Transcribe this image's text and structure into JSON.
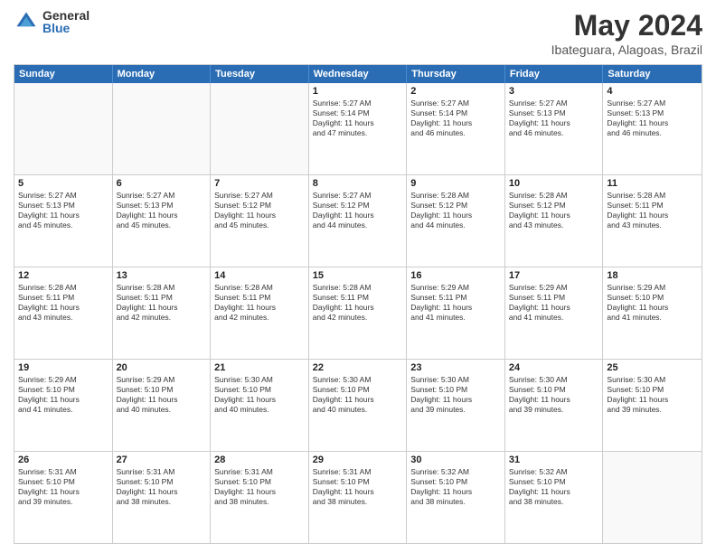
{
  "header": {
    "logo": {
      "general": "General",
      "blue": "Blue"
    },
    "title": "May 2024",
    "location": "Ibateguara, Alagoas, Brazil"
  },
  "calendar": {
    "days_of_week": [
      "Sunday",
      "Monday",
      "Tuesday",
      "Wednesday",
      "Thursday",
      "Friday",
      "Saturday"
    ],
    "weeks": [
      [
        {
          "day": "",
          "empty": true
        },
        {
          "day": "",
          "empty": true
        },
        {
          "day": "",
          "empty": true
        },
        {
          "day": "1",
          "line1": "Sunrise: 5:27 AM",
          "line2": "Sunset: 5:14 PM",
          "line3": "Daylight: 11 hours",
          "line4": "and 47 minutes."
        },
        {
          "day": "2",
          "line1": "Sunrise: 5:27 AM",
          "line2": "Sunset: 5:14 PM",
          "line3": "Daylight: 11 hours",
          "line4": "and 46 minutes."
        },
        {
          "day": "3",
          "line1": "Sunrise: 5:27 AM",
          "line2": "Sunset: 5:13 PM",
          "line3": "Daylight: 11 hours",
          "line4": "and 46 minutes."
        },
        {
          "day": "4",
          "line1": "Sunrise: 5:27 AM",
          "line2": "Sunset: 5:13 PM",
          "line3": "Daylight: 11 hours",
          "line4": "and 46 minutes."
        }
      ],
      [
        {
          "day": "5",
          "line1": "Sunrise: 5:27 AM",
          "line2": "Sunset: 5:13 PM",
          "line3": "Daylight: 11 hours",
          "line4": "and 45 minutes."
        },
        {
          "day": "6",
          "line1": "Sunrise: 5:27 AM",
          "line2": "Sunset: 5:13 PM",
          "line3": "Daylight: 11 hours",
          "line4": "and 45 minutes."
        },
        {
          "day": "7",
          "line1": "Sunrise: 5:27 AM",
          "line2": "Sunset: 5:12 PM",
          "line3": "Daylight: 11 hours",
          "line4": "and 45 minutes."
        },
        {
          "day": "8",
          "line1": "Sunrise: 5:27 AM",
          "line2": "Sunset: 5:12 PM",
          "line3": "Daylight: 11 hours",
          "line4": "and 44 minutes."
        },
        {
          "day": "9",
          "line1": "Sunrise: 5:28 AM",
          "line2": "Sunset: 5:12 PM",
          "line3": "Daylight: 11 hours",
          "line4": "and 44 minutes."
        },
        {
          "day": "10",
          "line1": "Sunrise: 5:28 AM",
          "line2": "Sunset: 5:12 PM",
          "line3": "Daylight: 11 hours",
          "line4": "and 43 minutes."
        },
        {
          "day": "11",
          "line1": "Sunrise: 5:28 AM",
          "line2": "Sunset: 5:11 PM",
          "line3": "Daylight: 11 hours",
          "line4": "and 43 minutes."
        }
      ],
      [
        {
          "day": "12",
          "line1": "Sunrise: 5:28 AM",
          "line2": "Sunset: 5:11 PM",
          "line3": "Daylight: 11 hours",
          "line4": "and 43 minutes."
        },
        {
          "day": "13",
          "line1": "Sunrise: 5:28 AM",
          "line2": "Sunset: 5:11 PM",
          "line3": "Daylight: 11 hours",
          "line4": "and 42 minutes."
        },
        {
          "day": "14",
          "line1": "Sunrise: 5:28 AM",
          "line2": "Sunset: 5:11 PM",
          "line3": "Daylight: 11 hours",
          "line4": "and 42 minutes."
        },
        {
          "day": "15",
          "line1": "Sunrise: 5:28 AM",
          "line2": "Sunset: 5:11 PM",
          "line3": "Daylight: 11 hours",
          "line4": "and 42 minutes."
        },
        {
          "day": "16",
          "line1": "Sunrise: 5:29 AM",
          "line2": "Sunset: 5:11 PM",
          "line3": "Daylight: 11 hours",
          "line4": "and 41 minutes."
        },
        {
          "day": "17",
          "line1": "Sunrise: 5:29 AM",
          "line2": "Sunset: 5:11 PM",
          "line3": "Daylight: 11 hours",
          "line4": "and 41 minutes."
        },
        {
          "day": "18",
          "line1": "Sunrise: 5:29 AM",
          "line2": "Sunset: 5:10 PM",
          "line3": "Daylight: 11 hours",
          "line4": "and 41 minutes."
        }
      ],
      [
        {
          "day": "19",
          "line1": "Sunrise: 5:29 AM",
          "line2": "Sunset: 5:10 PM",
          "line3": "Daylight: 11 hours",
          "line4": "and 41 minutes."
        },
        {
          "day": "20",
          "line1": "Sunrise: 5:29 AM",
          "line2": "Sunset: 5:10 PM",
          "line3": "Daylight: 11 hours",
          "line4": "and 40 minutes."
        },
        {
          "day": "21",
          "line1": "Sunrise: 5:30 AM",
          "line2": "Sunset: 5:10 PM",
          "line3": "Daylight: 11 hours",
          "line4": "and 40 minutes."
        },
        {
          "day": "22",
          "line1": "Sunrise: 5:30 AM",
          "line2": "Sunset: 5:10 PM",
          "line3": "Daylight: 11 hours",
          "line4": "and 40 minutes."
        },
        {
          "day": "23",
          "line1": "Sunrise: 5:30 AM",
          "line2": "Sunset: 5:10 PM",
          "line3": "Daylight: 11 hours",
          "line4": "and 39 minutes."
        },
        {
          "day": "24",
          "line1": "Sunrise: 5:30 AM",
          "line2": "Sunset: 5:10 PM",
          "line3": "Daylight: 11 hours",
          "line4": "and 39 minutes."
        },
        {
          "day": "25",
          "line1": "Sunrise: 5:30 AM",
          "line2": "Sunset: 5:10 PM",
          "line3": "Daylight: 11 hours",
          "line4": "and 39 minutes."
        }
      ],
      [
        {
          "day": "26",
          "line1": "Sunrise: 5:31 AM",
          "line2": "Sunset: 5:10 PM",
          "line3": "Daylight: 11 hours",
          "line4": "and 39 minutes."
        },
        {
          "day": "27",
          "line1": "Sunrise: 5:31 AM",
          "line2": "Sunset: 5:10 PM",
          "line3": "Daylight: 11 hours",
          "line4": "and 38 minutes."
        },
        {
          "day": "28",
          "line1": "Sunrise: 5:31 AM",
          "line2": "Sunset: 5:10 PM",
          "line3": "Daylight: 11 hours",
          "line4": "and 38 minutes."
        },
        {
          "day": "29",
          "line1": "Sunrise: 5:31 AM",
          "line2": "Sunset: 5:10 PM",
          "line3": "Daylight: 11 hours",
          "line4": "and 38 minutes."
        },
        {
          "day": "30",
          "line1": "Sunrise: 5:32 AM",
          "line2": "Sunset: 5:10 PM",
          "line3": "Daylight: 11 hours",
          "line4": "and 38 minutes."
        },
        {
          "day": "31",
          "line1": "Sunrise: 5:32 AM",
          "line2": "Sunset: 5:10 PM",
          "line3": "Daylight: 11 hours",
          "line4": "and 38 minutes."
        },
        {
          "day": "",
          "empty": true
        }
      ]
    ]
  }
}
